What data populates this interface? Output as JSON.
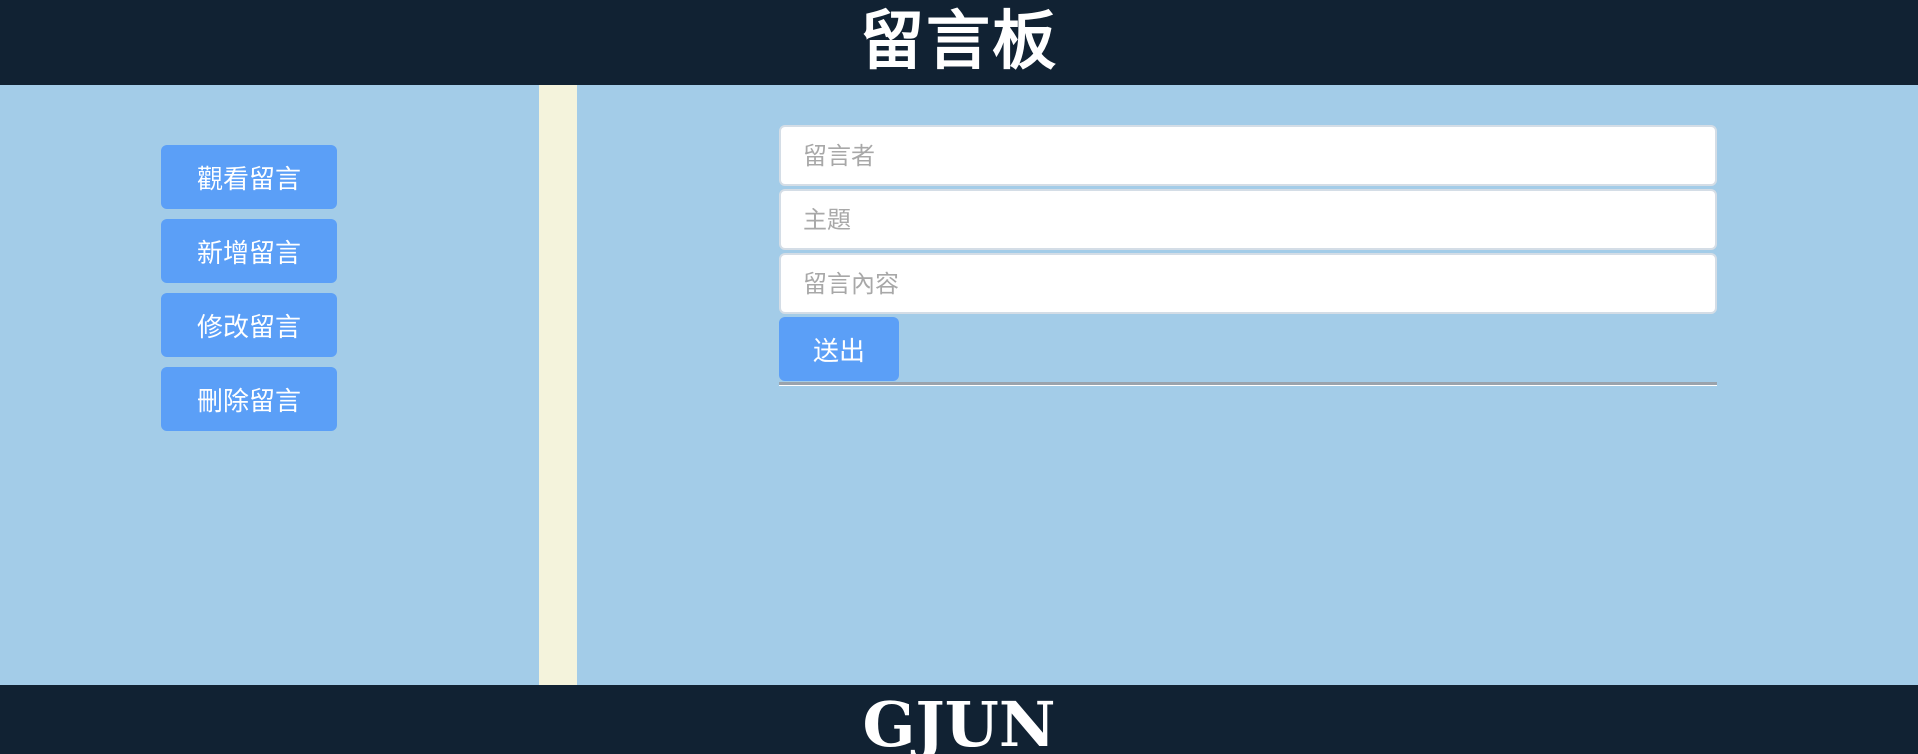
{
  "header": {
    "title": "留言板"
  },
  "sidebar": {
    "items": [
      {
        "label": "觀看留言"
      },
      {
        "label": "新增留言"
      },
      {
        "label": "修改留言"
      },
      {
        "label": "刪除留言"
      }
    ]
  },
  "form": {
    "author": {
      "placeholder": "留言者",
      "value": ""
    },
    "subject": {
      "placeholder": "主題",
      "value": ""
    },
    "content": {
      "placeholder": "留言內容",
      "value": ""
    },
    "submit_label": "送出"
  },
  "footer": {
    "text": "GJUN"
  },
  "colors": {
    "header_bg": "#112233",
    "page_bg": "#a3cce8",
    "strip_bg": "#f4f3dc",
    "button_bg": "#5b9ff7"
  }
}
